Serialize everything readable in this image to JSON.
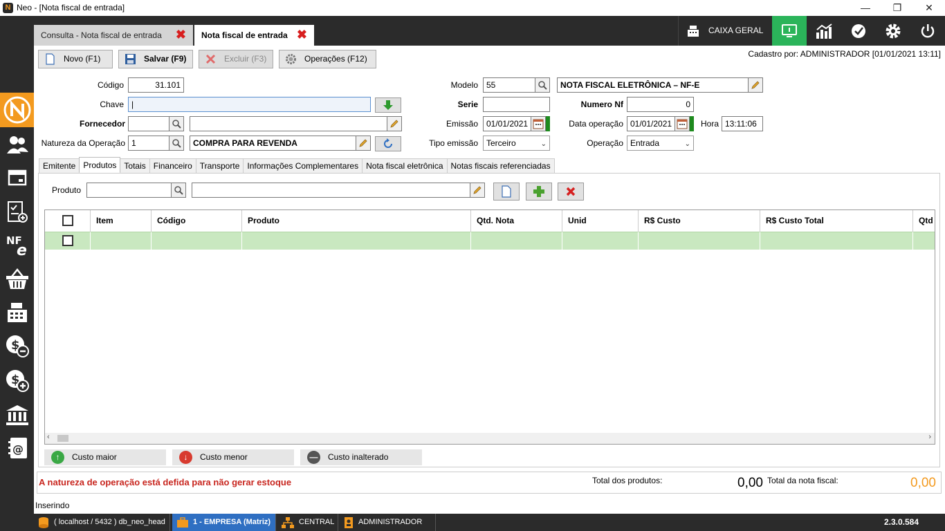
{
  "window": {
    "title": "Neo - [Nota fiscal de entrada]",
    "logo_letter": "N"
  },
  "tabs": [
    {
      "label": "Consulta - Nota fiscal de entrada"
    },
    {
      "label": "Nota fiscal de entrada"
    }
  ],
  "topbar": {
    "caixa_label": "CAIXA GERAL"
  },
  "toolbar": {
    "novo": "Novo (F1)",
    "salvar": "Salvar (F9)",
    "excluir": "Excluir (F3)",
    "operacoes": "Operações (F12)",
    "cadastro": "Cadastro por: ADMINISTRADOR [01/01/2021 13:11]"
  },
  "form": {
    "codigo_label": "Código",
    "codigo": "31.101",
    "chave_label": "Chave",
    "chave": "|",
    "fornecedor_label": "Fornecedor",
    "fornecedor_codigo": "",
    "fornecedor_nome": "",
    "natureza_label": "Natureza da Operação",
    "natureza_codigo": "1",
    "natureza_nome": "COMPRA PARA REVENDA",
    "modelo_label": "Modelo",
    "modelo_codigo": "55",
    "modelo_nome": "NOTA FISCAL ELETRÔNICA – NF-E",
    "serie_label": "Serie",
    "serie": "",
    "numero_label": "Numero Nf",
    "numero": "0",
    "emissao_label": "Emissão",
    "emissao": "01/01/2021",
    "data_op_label": "Data operação",
    "data_op": "01/01/2021",
    "hora_label": "Hora",
    "hora": "13:11:06",
    "tipo_emissao_label": "Tipo emissão",
    "tipo_emissao": "Terceiro",
    "operacao_label": "Operação",
    "operacao": "Entrada"
  },
  "subtabs": [
    "Emitente",
    "Produtos",
    "Totais",
    "Financeiro",
    "Transporte",
    "Informações Complementares",
    "Nota fiscal eletrônica",
    "Notas fiscais referenciadas"
  ],
  "produto": {
    "label": "Produto",
    "codigo": "",
    "nome": ""
  },
  "grid": {
    "columns": [
      "Item",
      "Código",
      "Produto",
      "Qtd. Nota",
      "Unid",
      "R$ Custo",
      "R$ Custo Total",
      "Qtd"
    ]
  },
  "legend": {
    "maior": "Custo maior",
    "menor": "Custo menor",
    "inalterado": "Custo inalterado"
  },
  "info": {
    "warning": "A natureza de operação está defida para não gerar estoque",
    "total_produtos_label": "Total dos produtos:",
    "total_produtos": "0,00",
    "total_nota_label": "Total da nota fiscal:",
    "total_nota": "0,00"
  },
  "status": "Inserindo",
  "footer": {
    "db": "( localhost / 5432 ) db_neo_head",
    "empresa": "1 - EMPRESA (Matriz)",
    "central": "CENTRAL",
    "user": "ADMINISTRADOR",
    "version": "2.3.0.584"
  }
}
